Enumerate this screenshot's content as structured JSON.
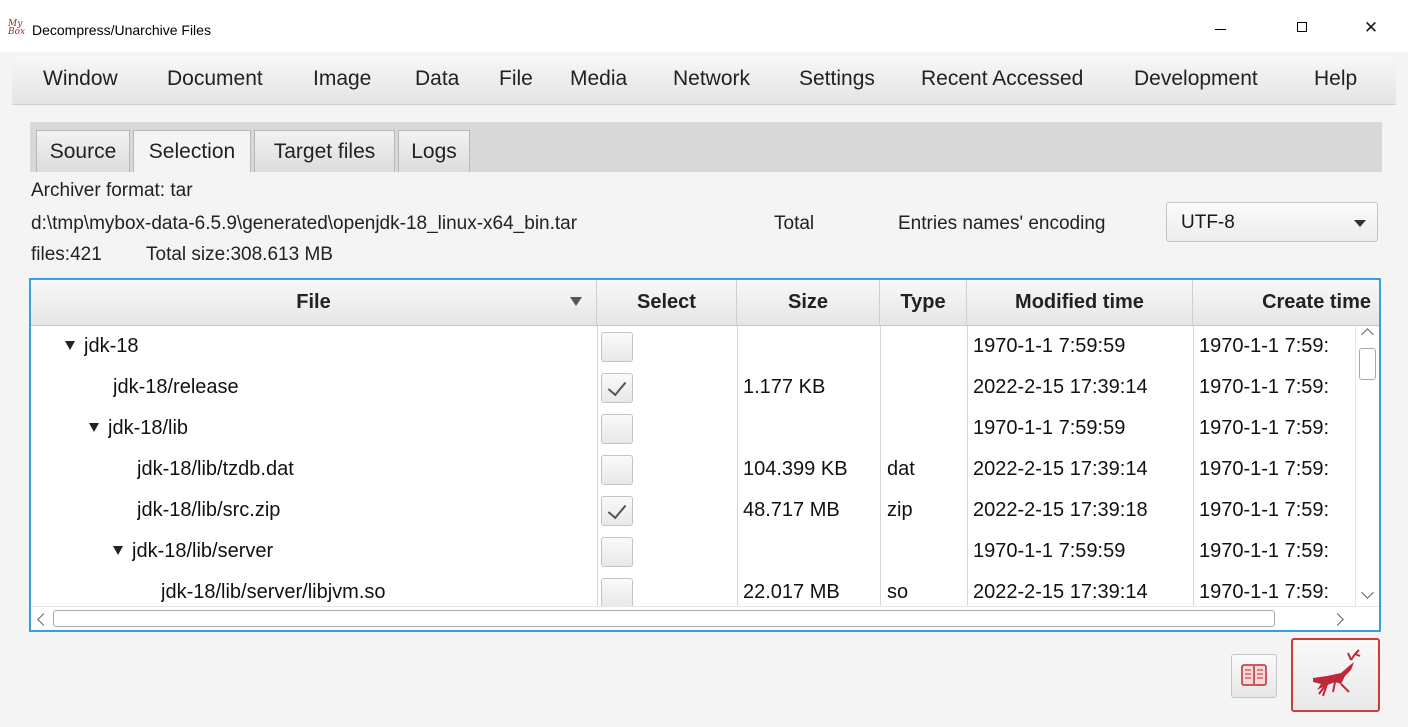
{
  "window": {
    "logo_line1": "My",
    "logo_line2": "Box",
    "title": "Decompress/Unarchive Files",
    "minimize_icon": "minimize-icon",
    "maximize_icon": "maximize-icon",
    "close_glyph": "✕"
  },
  "menu": {
    "items": [
      {
        "label": "Window"
      },
      {
        "label": "Document"
      },
      {
        "label": "Image"
      },
      {
        "label": "Data"
      },
      {
        "label": "File"
      },
      {
        "label": "Media"
      },
      {
        "label": "Network"
      },
      {
        "label": "Settings"
      },
      {
        "label": "Recent Accessed"
      },
      {
        "label": "Development"
      },
      {
        "label": "Help"
      }
    ]
  },
  "tabs": [
    {
      "label": "Source",
      "active": false
    },
    {
      "label": "Selection",
      "active": true
    },
    {
      "label": "Target files",
      "active": false
    },
    {
      "label": "Logs",
      "active": false
    }
  ],
  "info": {
    "archiver_format": "Archiver format: tar",
    "path": "d:\\tmp\\mybox-data-6.5.9\\generated\\openjdk-18_linux-x64_bin.tar",
    "total_label": "Total",
    "total_files": "files:421",
    "total_size": "Total size:308.613 MB",
    "encoding_label": "Entries names' encoding",
    "encoding_value": "UTF-8"
  },
  "table": {
    "headers": {
      "file": "File",
      "select": "Select",
      "size": "Size",
      "type": "Type",
      "modified": "Modified time",
      "create": "Create time"
    },
    "rows": [
      {
        "file": "jdk-18",
        "expanded": true,
        "checked": false,
        "size": "",
        "type": "",
        "modified": "1970-1-1 7:59:59",
        "create": "1970-1-1 7:59:"
      },
      {
        "file": "jdk-18/release",
        "expanded": false,
        "checked": true,
        "size": "1.177 KB",
        "type": "",
        "modified": "2022-2-15 17:39:14",
        "create": "1970-1-1 7:59:"
      },
      {
        "file": "jdk-18/lib",
        "expanded": true,
        "checked": false,
        "size": "",
        "type": "",
        "modified": "1970-1-1 7:59:59",
        "create": "1970-1-1 7:59:"
      },
      {
        "file": "jdk-18/lib/tzdb.dat",
        "expanded": false,
        "checked": false,
        "size": "104.399 KB",
        "type": "dat",
        "modified": "2022-2-15 17:39:14",
        "create": "1970-1-1 7:59:"
      },
      {
        "file": "jdk-18/lib/src.zip",
        "expanded": false,
        "checked": true,
        "size": "48.717 MB",
        "type": "zip",
        "modified": "2022-2-15 17:39:18",
        "create": "1970-1-1 7:59:"
      },
      {
        "file": "jdk-18/lib/server",
        "expanded": true,
        "checked": false,
        "size": "",
        "type": "",
        "modified": "1970-1-1 7:59:59",
        "create": "1970-1-1 7:59:"
      },
      {
        "file": "jdk-18/lib/server/libjvm.so",
        "expanded": false,
        "checked": false,
        "size": "22.017 MB",
        "type": "so",
        "modified": "2022-2-15 17:39:14",
        "create": "1970-1-1 7:59:"
      }
    ]
  },
  "buttons": {
    "help_icon": "book-icon",
    "start_icon": "deer-runner-icon"
  },
  "colors": {
    "accent_border": "#3aa0d8",
    "start_border": "#d03a3a",
    "icon_red": "#c0283a"
  }
}
